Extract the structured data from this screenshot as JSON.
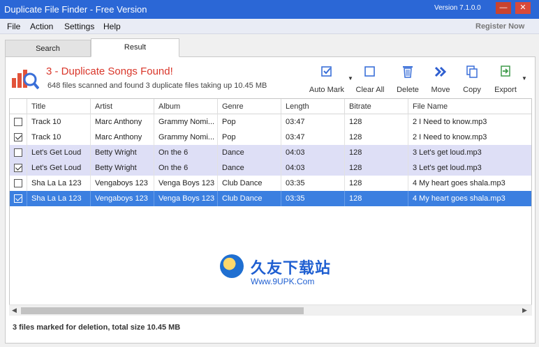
{
  "window": {
    "title": "Duplicate File Finder - Free Version",
    "version": "Version 7.1.0.0",
    "minimize": "—",
    "close": "✕"
  },
  "menu": {
    "file": "File",
    "action": "Action",
    "settings": "Settings",
    "help": "Help",
    "register": "Register Now"
  },
  "tabs": {
    "search": "Search",
    "result": "Result"
  },
  "header": {
    "headline": "3 - Duplicate Songs Found!",
    "subline": "648 files scanned and found 3 duplicate files taking up 10.45 MB"
  },
  "toolbar": {
    "auto_mark": "Auto Mark",
    "clear_all": "Clear All",
    "delete": "Delete",
    "move": "Move",
    "copy": "Copy",
    "export": "Export"
  },
  "columns": [
    "Title",
    "Artist",
    "Album",
    "Genre",
    "Length",
    "Bitrate",
    "File Name"
  ],
  "rows": [
    {
      "checked": false,
      "style": "even",
      "title": "Track 10",
      "artist": "Marc Anthony",
      "album": "Grammy Nomi...",
      "genre": "Pop",
      "length": "03:47",
      "bitrate": "128",
      "file": "2 I Need to know.mp3"
    },
    {
      "checked": true,
      "style": "even",
      "title": "Track 10",
      "artist": "Marc Anthony",
      "album": "Grammy Nomi...",
      "genre": "Pop",
      "length": "03:47",
      "bitrate": "128",
      "file": "2 I Need to know.mp3"
    },
    {
      "checked": false,
      "style": "marked",
      "title": "Let's Get Loud",
      "artist": "Betty Wright",
      "album": "On the 6",
      "genre": "Dance",
      "length": "04:03",
      "bitrate": "128",
      "file": "3 Let's get loud.mp3"
    },
    {
      "checked": true,
      "style": "marked",
      "title": "Let's Get Loud",
      "artist": "Betty Wright",
      "album": "On the 6",
      "genre": "Dance",
      "length": "04:03",
      "bitrate": "128",
      "file": "3 Let's get loud.mp3"
    },
    {
      "checked": false,
      "style": "even",
      "title": "Sha La La 123",
      "artist": "Vengaboys 123",
      "album": "Venga Boys 123",
      "genre": "Club Dance",
      "length": "03:35",
      "bitrate": "128",
      "file": "4 My heart goes shala.mp3"
    },
    {
      "checked": true,
      "style": "selected",
      "title": "Sha La La 123",
      "artist": "Vengaboys 123",
      "album": "Venga Boys 123",
      "genre": "Club Dance",
      "length": "03:35",
      "bitrate": "128",
      "file": "4 My heart goes shala.mp3"
    }
  ],
  "watermark": {
    "cn": "久友下载站",
    "url": "Www.9UPK.Com"
  },
  "status": "3 files marked for deletion, total size 10.45 MB",
  "colors": {
    "titlebar": "#2b67d6",
    "headline": "#d9362a",
    "selected_row": "#3b7fe0",
    "marked_row": "#dedff6",
    "toolbar_icon": "#3a6fd8"
  }
}
